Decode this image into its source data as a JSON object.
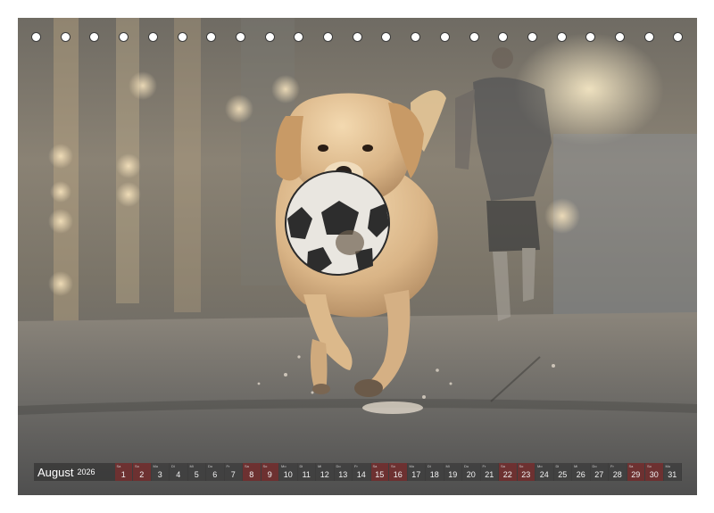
{
  "calendar": {
    "month": "August",
    "year": "2026",
    "days": [
      {
        "n": "1",
        "w": "Sa",
        "we": true
      },
      {
        "n": "2",
        "w": "So",
        "we": true
      },
      {
        "n": "3",
        "w": "Mo",
        "we": false
      },
      {
        "n": "4",
        "w": "Di",
        "we": false
      },
      {
        "n": "5",
        "w": "Mi",
        "we": false
      },
      {
        "n": "6",
        "w": "Do",
        "we": false
      },
      {
        "n": "7",
        "w": "Fr",
        "we": false
      },
      {
        "n": "8",
        "w": "Sa",
        "we": true
      },
      {
        "n": "9",
        "w": "So",
        "we": true
      },
      {
        "n": "10",
        "w": "Mo",
        "we": false
      },
      {
        "n": "11",
        "w": "Di",
        "we": false
      },
      {
        "n": "12",
        "w": "Mi",
        "we": false
      },
      {
        "n": "13",
        "w": "Do",
        "we": false
      },
      {
        "n": "14",
        "w": "Fr",
        "we": false
      },
      {
        "n": "15",
        "w": "Sa",
        "we": true
      },
      {
        "n": "16",
        "w": "So",
        "we": true
      },
      {
        "n": "17",
        "w": "Mo",
        "we": false
      },
      {
        "n": "18",
        "w": "Di",
        "we": false
      },
      {
        "n": "19",
        "w": "Mi",
        "we": false
      },
      {
        "n": "20",
        "w": "Do",
        "we": false
      },
      {
        "n": "21",
        "w": "Fr",
        "we": false
      },
      {
        "n": "22",
        "w": "Sa",
        "we": true
      },
      {
        "n": "23",
        "w": "So",
        "we": true
      },
      {
        "n": "24",
        "w": "Mo",
        "we": false
      },
      {
        "n": "25",
        "w": "Di",
        "we": false
      },
      {
        "n": "26",
        "w": "Mi",
        "we": false
      },
      {
        "n": "27",
        "w": "Do",
        "we": false
      },
      {
        "n": "28",
        "w": "Fr",
        "we": false
      },
      {
        "n": "29",
        "w": "Sa",
        "we": true
      },
      {
        "n": "30",
        "w": "So",
        "we": true
      },
      {
        "n": "31",
        "w": "Mo",
        "we": false
      }
    ]
  }
}
